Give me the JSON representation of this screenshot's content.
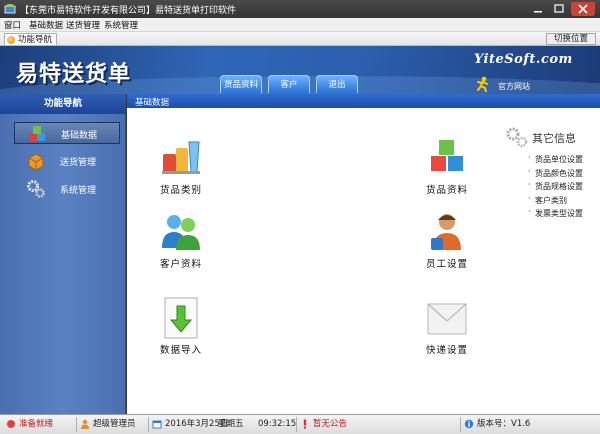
{
  "window": {
    "title": "【东莞市易特软件开发有限公司】易特送货单打印软件"
  },
  "menu": [
    "窗口",
    "基础数据",
    "送货管理",
    "系统管理"
  ],
  "tabbar": {
    "nav_tab": "功能导航",
    "switch_button": "切换位置"
  },
  "banner": {
    "logo": "易特送货单",
    "site": "YiteSoft.com",
    "tabs": [
      "货品资料",
      "客户",
      "退出"
    ],
    "official": "官方网站"
  },
  "sidebar": {
    "title": "功能导航",
    "items": [
      {
        "label": "基础数据",
        "active": true
      },
      {
        "label": "送货管理",
        "active": false
      },
      {
        "label": "系统管理",
        "active": false
      }
    ]
  },
  "content": {
    "breadcrumb": "基础数据",
    "features": [
      {
        "label": "货品类别",
        "icon": "product-category-icon"
      },
      {
        "label": "货品资料",
        "icon": "product-info-icon"
      },
      {
        "label": "客户资料",
        "icon": "customer-info-icon"
      },
      {
        "label": "员工设置",
        "icon": "employee-settings-icon"
      },
      {
        "label": "数据导入",
        "icon": "data-import-icon"
      },
      {
        "label": "快递设置",
        "icon": "express-settings-icon"
      }
    ],
    "other_info": {
      "title": "其它信息",
      "links": [
        "货品单位设置",
        "货品颜色设置",
        "货品规格设置",
        "客户类别",
        "发票类型设置"
      ]
    }
  },
  "status": {
    "ready": "准备就绪",
    "user": "超级管理员",
    "date": "2016年3月25日",
    "weekday": "星期五",
    "time": "09:32:15",
    "notice": "暂无公告",
    "version": "版本号：V1.6"
  }
}
